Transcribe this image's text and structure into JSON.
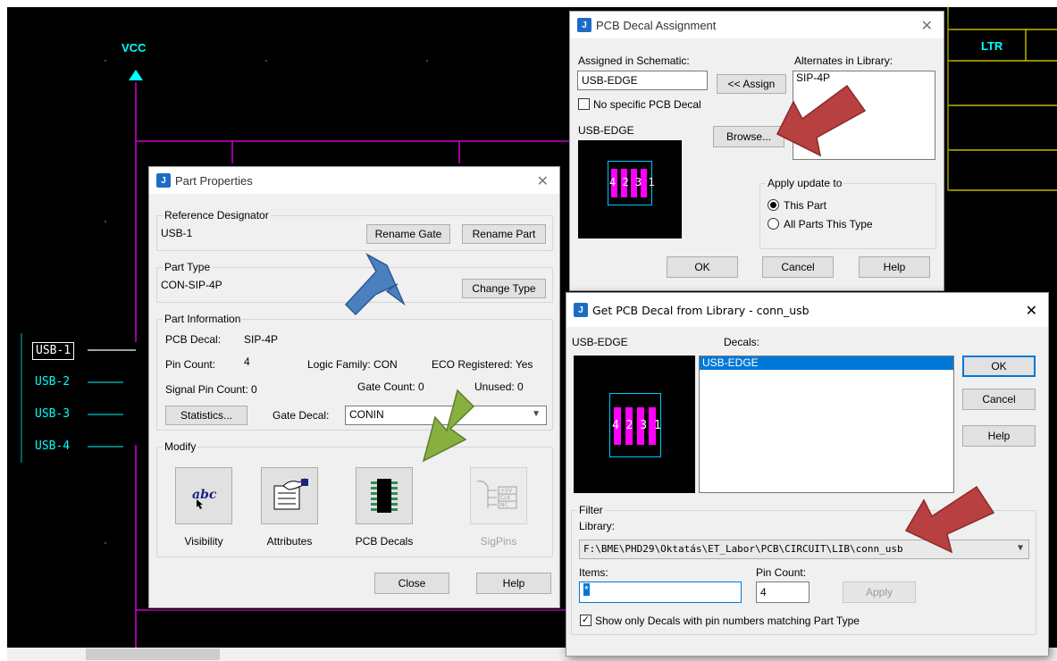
{
  "schematic": {
    "power_label": "VCC",
    "corner_label": "LTR",
    "net_labels": [
      "USB-1",
      "USB-2",
      "USB-3",
      "USB-4"
    ]
  },
  "part_props": {
    "title": "Part Properties",
    "refdes_group": "Reference Designator",
    "refdes_value": "USB-1",
    "rename_gate": "Rename Gate",
    "rename_part": "Rename Part",
    "parttype_group": "Part Type",
    "parttype_value": "CON-SIP-4P",
    "change_type": "Change Type",
    "info_group": "Part Information",
    "pcb_decal_label": "PCB Decal:",
    "pcb_decal_value": "SIP-4P",
    "pin_count_label": "Pin Count:",
    "pin_count_value": "4",
    "logic_family": "Logic Family:  CON",
    "eco_registered": "ECO Registered: Yes",
    "signal_pin_count": "Signal Pin Count:   0",
    "gate_count": "Gate Count:  0",
    "unused": "Unused:  0",
    "statistics": "Statistics...",
    "gate_decal_label": "Gate Decal:",
    "gate_decal_value": "CONIN",
    "modify_group": "Modify",
    "visibility": "Visibility",
    "attributes": "Attributes",
    "pcb_decals": "PCB Decals",
    "sigpins": "SigPins",
    "close": "Close",
    "help": "Help"
  },
  "decal_assign": {
    "title": "PCB Decal Assignment",
    "assigned_label": "Assigned in Schematic:",
    "assigned_value": "USB-EDGE",
    "assign_btn": "<< Assign",
    "alternates_label": "Alternates in Library:",
    "alternates": [
      "SIP-4P"
    ],
    "no_specific": "No specific PCB Decal",
    "preview_label": "USB-EDGE",
    "browse": "Browse...",
    "apply_group": "Apply update to",
    "this_part": "This Part",
    "all_parts": "All Parts This Type",
    "ok": "OK",
    "cancel": "Cancel",
    "help": "Help"
  },
  "get_decal": {
    "title": "Get PCB Decal from Library - conn_usb",
    "preview_label": "USB-EDGE",
    "decals_label": "Decals:",
    "decals": [
      "USB-EDGE"
    ],
    "ok": "OK",
    "cancel": "Cancel",
    "help": "Help",
    "filter_group": "Filter",
    "library_label": "Library:",
    "library_value": "F:\\BME\\PHD29\\Oktatás\\ET_Labor\\PCB\\CIRCUIT\\LIB\\conn_usb",
    "items_label": "Items:",
    "items_value": "*",
    "pin_count_label": "Pin Count:",
    "pin_count_value": "4",
    "apply": "Apply",
    "show_only": "Show only Decals with pin numbers matching Part Type"
  },
  "decal_pins": "4 2 3 1",
  "colors": {
    "canvas": "#000000",
    "wire_magenta": "#d000d0",
    "wire_cyan": "#00c8c8",
    "border_yellow": "#e8e000",
    "pad": "#ff00ff",
    "arrow_red": "#b84040",
    "arrow_blue": "#4a7fc0",
    "arrow_green": "#88b040"
  }
}
